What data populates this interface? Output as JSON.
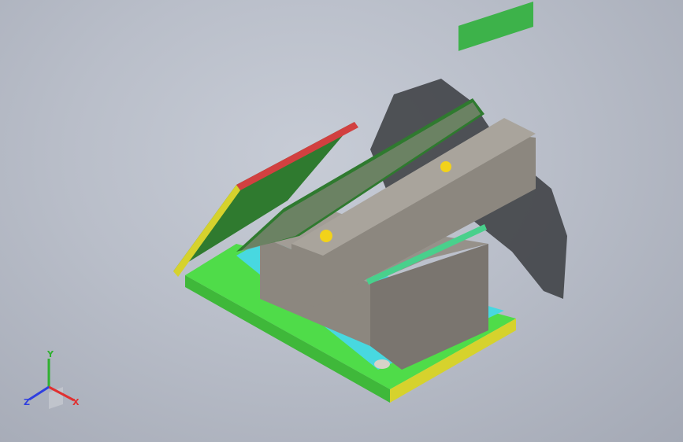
{
  "viewport": {
    "background_top": "#c7ccd6",
    "background_bottom": "#a4a9b5"
  },
  "model": {
    "colors": {
      "base_plate": "#4fdc49",
      "base_plate_edge": "#d6d22d",
      "sub_plate": "#48d8e0",
      "panel_green": "#2f7a2f",
      "panel_red": "#d24040",
      "body_grey": "#8c877f",
      "housing_grey": "#7a756f",
      "gear_yellow": "#f2d21a",
      "shadow": "#3a3c40",
      "rail_green": "#49d08c",
      "display_green": "#3db24a"
    }
  },
  "triad": {
    "x_label": "X",
    "y_label": "Y",
    "z_label": "Z",
    "x_color": "#e03030",
    "y_color": "#2fb02f",
    "z_color": "#2f3fe0"
  }
}
